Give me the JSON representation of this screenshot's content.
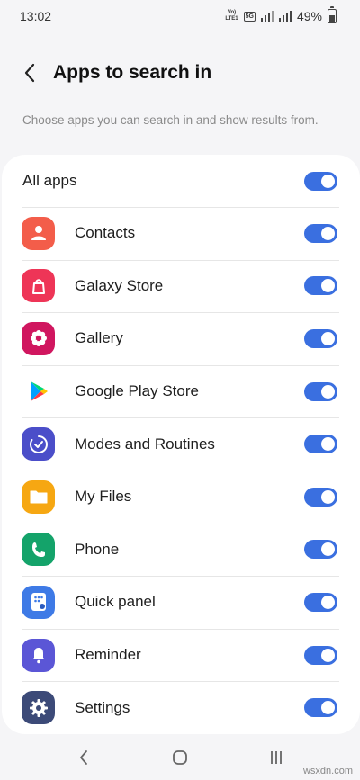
{
  "status_bar": {
    "time": "13:02",
    "volte_line1": "Vo)",
    "volte_line2": "LTE1",
    "network": "5G",
    "battery": "49%",
    "battery_level": 0.49
  },
  "header": {
    "title": "Apps to search in"
  },
  "subtitle": "Choose apps you can search in and show results from.",
  "all_apps": {
    "label": "All apps",
    "enabled": true
  },
  "apps": [
    {
      "label": "Contacts",
      "icon": "contacts-icon",
      "color": "#f35d4a",
      "enabled": true
    },
    {
      "label": "Galaxy Store",
      "icon": "galaxy-store-icon",
      "color": "#ee3557",
      "enabled": true
    },
    {
      "label": "Gallery",
      "icon": "gallery-icon",
      "color": "#d0165f",
      "enabled": true
    },
    {
      "label": "Google Play Store",
      "icon": "google-play-icon",
      "color": "#ffffff",
      "enabled": true
    },
    {
      "label": "Modes and Routines",
      "icon": "modes-routines-icon",
      "color": "#4b4ec9",
      "enabled": true
    },
    {
      "label": "My Files",
      "icon": "my-files-icon",
      "color": "#f6a712",
      "enabled": true
    },
    {
      "label": "Phone",
      "icon": "phone-icon",
      "color": "#14a36a",
      "enabled": true
    },
    {
      "label": "Quick panel",
      "icon": "quick-panel-icon",
      "color": "#3e7ae6",
      "enabled": true
    },
    {
      "label": "Reminder",
      "icon": "reminder-icon",
      "color": "#5b56d6",
      "enabled": true
    },
    {
      "label": "Settings",
      "icon": "settings-icon",
      "color": "#3c4a78",
      "enabled": true
    }
  ],
  "toggle_color": "#3a6fe0",
  "watermark": "wsxdn.com"
}
